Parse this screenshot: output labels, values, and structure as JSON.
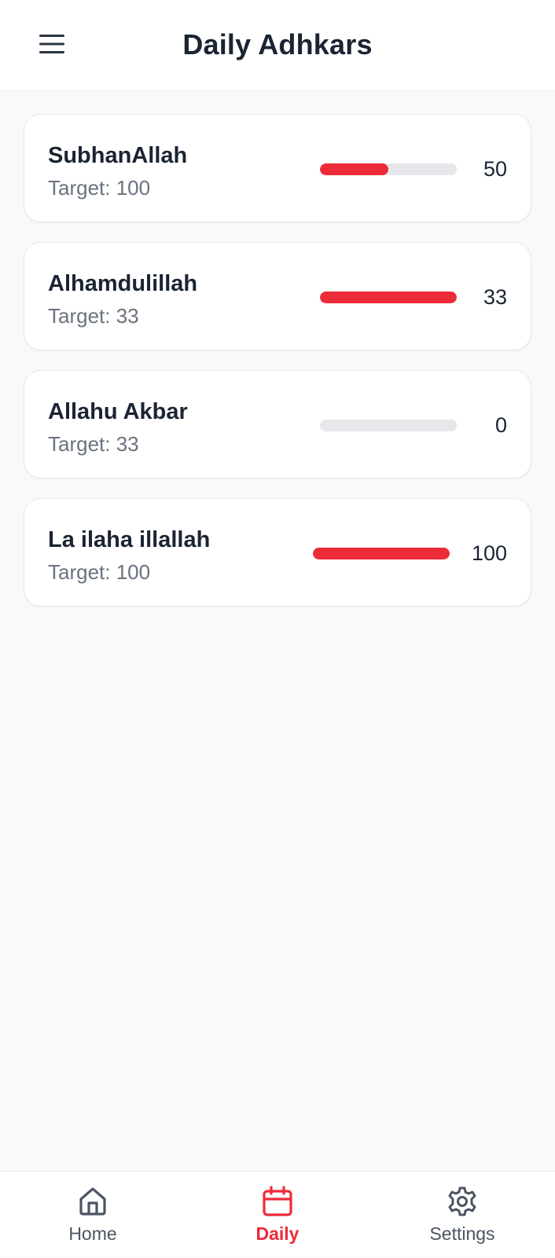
{
  "header": {
    "title": "Daily Adhkars",
    "menu_icon": "hamburger-menu-icon"
  },
  "adhkars": [
    {
      "name": "SubhanAllah",
      "target_label": "Target: 100",
      "count": "50",
      "progress": 0.5
    },
    {
      "name": "Alhamdulillah",
      "target_label": "Target: 33",
      "count": "33",
      "progress": 1.0
    },
    {
      "name": "Allahu Akbar",
      "target_label": "Target: 33",
      "count": "0",
      "progress": 0.0
    },
    {
      "name": "La ilaha illallah",
      "target_label": "Target: 100",
      "count": "100",
      "progress": 1.0
    }
  ],
  "nav": {
    "active": "daily",
    "items": [
      {
        "id": "home",
        "label": "Home",
        "icon": "home-icon"
      },
      {
        "id": "daily",
        "label": "Daily",
        "icon": "calendar-icon"
      },
      {
        "id": "settings",
        "label": "Settings",
        "icon": "gear-icon"
      }
    ]
  },
  "colors": {
    "accent": "#ec2b38",
    "track": "#e5e7eb",
    "text": "#1b2433",
    "muted": "#6b7280",
    "background": "#f8f9fb"
  }
}
